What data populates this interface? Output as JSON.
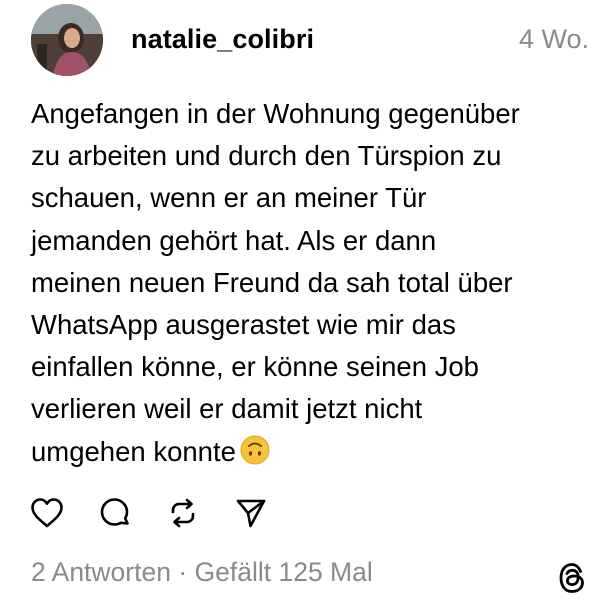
{
  "post": {
    "username": "natalie_colibri",
    "timestamp": "4 Wo.",
    "text": "Angefangen in der Wohnung gegenüber\nzu arbeiten und durch den Türspion zu\nschauen, wenn er an meiner Tür\njemanden gehört hat. Als er dann\nmeinen neuen Freund da sah total über\nWhatsApp ausgerastet wie mir das\neinfallen könne, er könne seinen Job\nverlieren weil er damit jetzt nicht\numgehen konnte",
    "emoji": "upside-down-face",
    "stats": {
      "replies": "2 Antworten",
      "separator": "·",
      "likes": "Gefällt 125 Mal"
    }
  },
  "actions": [
    {
      "name": "like-button",
      "icon": "heart-icon"
    },
    {
      "name": "reply-button",
      "icon": "comment-icon"
    },
    {
      "name": "repost-button",
      "icon": "repost-icon"
    },
    {
      "name": "share-button",
      "icon": "send-icon"
    }
  ],
  "brand": {
    "logo": "threads-logo-icon"
  },
  "colors": {
    "text": "#000000",
    "secondary_text": "#8a8a8a",
    "background": "#ffffff",
    "emoji_face": "#f7c23a"
  }
}
